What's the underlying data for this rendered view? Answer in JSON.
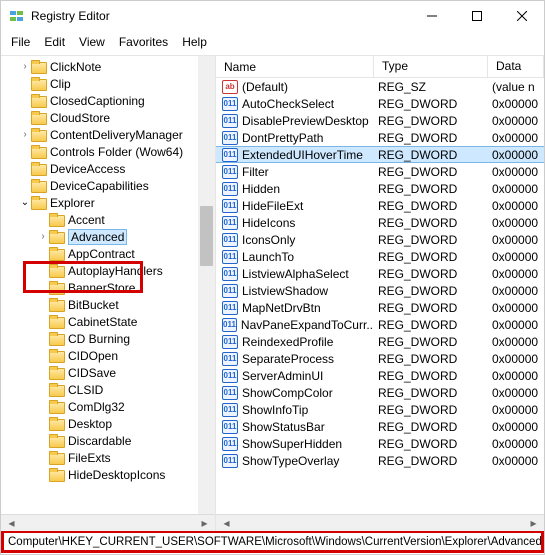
{
  "window": {
    "title": "Registry Editor"
  },
  "menu": {
    "file": "File",
    "edit": "Edit",
    "view": "View",
    "favorites": "Favorites",
    "help": "Help"
  },
  "tree": {
    "items": [
      {
        "indent": 1,
        "expand": "collapsed",
        "label": "ClickNote"
      },
      {
        "indent": 1,
        "expand": "none",
        "label": "Clip"
      },
      {
        "indent": 1,
        "expand": "none",
        "label": "ClosedCaptioning"
      },
      {
        "indent": 1,
        "expand": "none",
        "label": "CloudStore"
      },
      {
        "indent": 1,
        "expand": "collapsed",
        "label": "ContentDeliveryManager"
      },
      {
        "indent": 1,
        "expand": "none",
        "label": "Controls Folder (Wow64)"
      },
      {
        "indent": 1,
        "expand": "none",
        "label": "DeviceAccess"
      },
      {
        "indent": 1,
        "expand": "none",
        "label": "DeviceCapabilities"
      },
      {
        "indent": 1,
        "expand": "open",
        "label": "Explorer"
      },
      {
        "indent": 2,
        "expand": "none",
        "label": "Accent"
      },
      {
        "indent": 2,
        "expand": "collapsed",
        "label": "Advanced",
        "selected": true
      },
      {
        "indent": 2,
        "expand": "none",
        "label": "AppContract"
      },
      {
        "indent": 2,
        "expand": "none",
        "label": "AutoplayHandlers"
      },
      {
        "indent": 2,
        "expand": "none",
        "label": "BannerStore"
      },
      {
        "indent": 2,
        "expand": "none",
        "label": "BitBucket"
      },
      {
        "indent": 2,
        "expand": "none",
        "label": "CabinetState"
      },
      {
        "indent": 2,
        "expand": "none",
        "label": "CD Burning"
      },
      {
        "indent": 2,
        "expand": "none",
        "label": "CIDOpen"
      },
      {
        "indent": 2,
        "expand": "none",
        "label": "CIDSave"
      },
      {
        "indent": 2,
        "expand": "none",
        "label": "CLSID"
      },
      {
        "indent": 2,
        "expand": "none",
        "label": "ComDlg32"
      },
      {
        "indent": 2,
        "expand": "none",
        "label": "Desktop"
      },
      {
        "indent": 2,
        "expand": "none",
        "label": "Discardable"
      },
      {
        "indent": 2,
        "expand": "none",
        "label": "FileExts"
      },
      {
        "indent": 2,
        "expand": "none",
        "label": "HideDesktopIcons"
      }
    ]
  },
  "list": {
    "header": {
      "name": "Name",
      "type": "Type",
      "data": "Data"
    },
    "rows": [
      {
        "icon": "sz",
        "name": "(Default)",
        "type": "REG_SZ",
        "data": "(value n",
        "selected": false
      },
      {
        "icon": "dw",
        "name": "AutoCheckSelect",
        "type": "REG_DWORD",
        "data": "0x00000",
        "selected": false
      },
      {
        "icon": "dw",
        "name": "DisablePreviewDesktop",
        "type": "REG_DWORD",
        "data": "0x00000",
        "selected": false
      },
      {
        "icon": "dw",
        "name": "DontPrettyPath",
        "type": "REG_DWORD",
        "data": "0x00000",
        "selected": false
      },
      {
        "icon": "dw",
        "name": "ExtendedUIHoverTime",
        "type": "REG_DWORD",
        "data": "0x00000",
        "selected": true
      },
      {
        "icon": "dw",
        "name": "Filter",
        "type": "REG_DWORD",
        "data": "0x00000",
        "selected": false
      },
      {
        "icon": "dw",
        "name": "Hidden",
        "type": "REG_DWORD",
        "data": "0x00000",
        "selected": false
      },
      {
        "icon": "dw",
        "name": "HideFileExt",
        "type": "REG_DWORD",
        "data": "0x00000",
        "selected": false
      },
      {
        "icon": "dw",
        "name": "HideIcons",
        "type": "REG_DWORD",
        "data": "0x00000",
        "selected": false
      },
      {
        "icon": "dw",
        "name": "IconsOnly",
        "type": "REG_DWORD",
        "data": "0x00000",
        "selected": false
      },
      {
        "icon": "dw",
        "name": "LaunchTo",
        "type": "REG_DWORD",
        "data": "0x00000",
        "selected": false
      },
      {
        "icon": "dw",
        "name": "ListviewAlphaSelect",
        "type": "REG_DWORD",
        "data": "0x00000",
        "selected": false
      },
      {
        "icon": "dw",
        "name": "ListviewShadow",
        "type": "REG_DWORD",
        "data": "0x00000",
        "selected": false
      },
      {
        "icon": "dw",
        "name": "MapNetDrvBtn",
        "type": "REG_DWORD",
        "data": "0x00000",
        "selected": false
      },
      {
        "icon": "dw",
        "name": "NavPaneExpandToCurr...",
        "type": "REG_DWORD",
        "data": "0x00000",
        "selected": false
      },
      {
        "icon": "dw",
        "name": "ReindexedProfile",
        "type": "REG_DWORD",
        "data": "0x00000",
        "selected": false
      },
      {
        "icon": "dw",
        "name": "SeparateProcess",
        "type": "REG_DWORD",
        "data": "0x00000",
        "selected": false
      },
      {
        "icon": "dw",
        "name": "ServerAdminUI",
        "type": "REG_DWORD",
        "data": "0x00000",
        "selected": false
      },
      {
        "icon": "dw",
        "name": "ShowCompColor",
        "type": "REG_DWORD",
        "data": "0x00000",
        "selected": false
      },
      {
        "icon": "dw",
        "name": "ShowInfoTip",
        "type": "REG_DWORD",
        "data": "0x00000",
        "selected": false
      },
      {
        "icon": "dw",
        "name": "ShowStatusBar",
        "type": "REG_DWORD",
        "data": "0x00000",
        "selected": false
      },
      {
        "icon": "dw",
        "name": "ShowSuperHidden",
        "type": "REG_DWORD",
        "data": "0x00000",
        "selected": false
      },
      {
        "icon": "dw",
        "name": "ShowTypeOverlay",
        "type": "REG_DWORD",
        "data": "0x00000",
        "selected": false
      }
    ]
  },
  "statusbar": {
    "path": "Computer\\HKEY_CURRENT_USER\\SOFTWARE\\Microsoft\\Windows\\CurrentVersion\\Explorer\\Advanced"
  },
  "icons": {
    "sz_glyph": "ab",
    "dw_glyph": "011"
  }
}
